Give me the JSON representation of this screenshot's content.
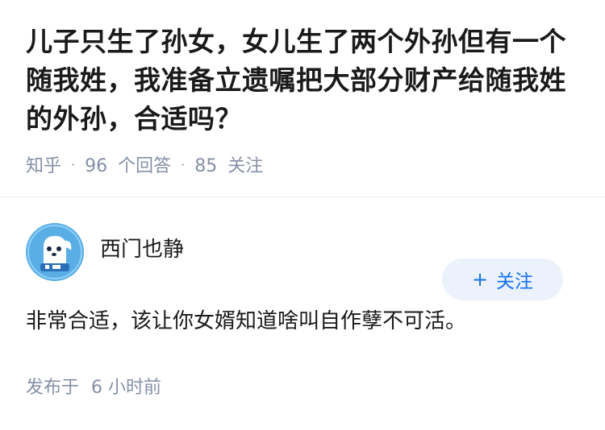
{
  "question": {
    "title": "儿子只生了孙女，女儿生了两个外孙但有一个随我姓，我准备立遗嘱把大部分财产给随我姓的外孙，合适吗？",
    "source": "知乎",
    "answers_count": "96",
    "answers_label": "个回答",
    "followers_count": "85",
    "followers_label": "关注"
  },
  "answer": {
    "author_name": "西门也静",
    "follow_button_label": "关注",
    "follow_button_prefix": "+",
    "text": "非常合适，该让你女婿知道啥叫自作孽不可活。",
    "time_prefix": "发布于",
    "time_value": "6 小时前"
  },
  "colors": {
    "accent": "#1772f6",
    "follow_bg": "#ebf2fb",
    "meta_text": "#8590a6",
    "avatar_bg": "#5aaee6"
  },
  "icons": {
    "avatar": "cartoon-dog-avatar-icon"
  }
}
